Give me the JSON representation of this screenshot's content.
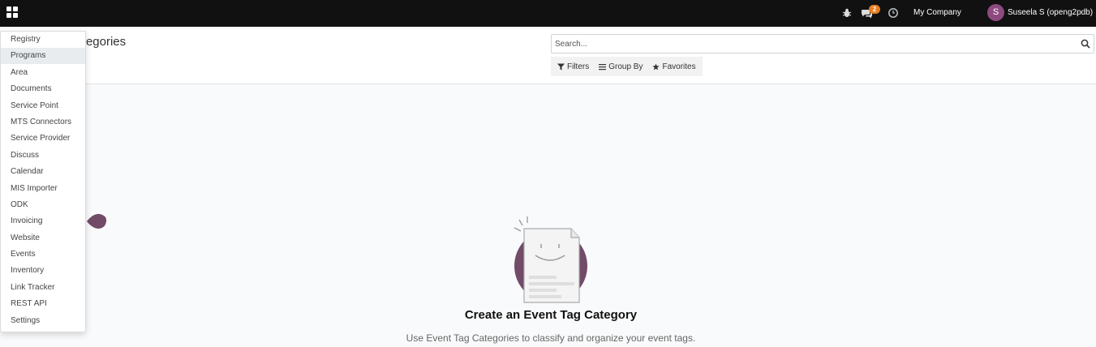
{
  "navbar": {
    "apps_icon": "apps-grid-icon",
    "debug_icon": "bug-icon",
    "messages_icon": "chat-icon",
    "messages_count": "2",
    "activity_icon": "clock-icon",
    "company": "My Company",
    "avatar_letter": "S",
    "avatar_color": "#8e4a7e",
    "username": "Suseela S (openg2pdb)"
  },
  "control_panel": {
    "title": "Event Tag Categories",
    "search_placeholder": "Search...",
    "filters_label": "Filters",
    "group_by_label": "Group By",
    "favorites_label": "Favorites"
  },
  "apps_menu": {
    "items": [
      {
        "label": "Registry"
      },
      {
        "label": "Programs",
        "active": true
      },
      {
        "label": "Area"
      },
      {
        "label": "Documents"
      },
      {
        "label": "Service Point"
      },
      {
        "label": "MTS Connectors"
      },
      {
        "label": "Service Provider"
      },
      {
        "label": "Discuss"
      },
      {
        "label": "Calendar"
      },
      {
        "label": "MIS Importer"
      },
      {
        "label": "ODK"
      },
      {
        "label": "Invoicing"
      },
      {
        "label": "Website"
      },
      {
        "label": "Events"
      },
      {
        "label": "Inventory"
      },
      {
        "label": "Link Tracker"
      },
      {
        "label": "REST API"
      },
      {
        "label": "Settings"
      }
    ]
  },
  "empty_state": {
    "title": "Create an Event Tag Category",
    "help": "Use Event Tag Categories to classify and organize your event tags.",
    "illustration_color": "#714b67"
  }
}
